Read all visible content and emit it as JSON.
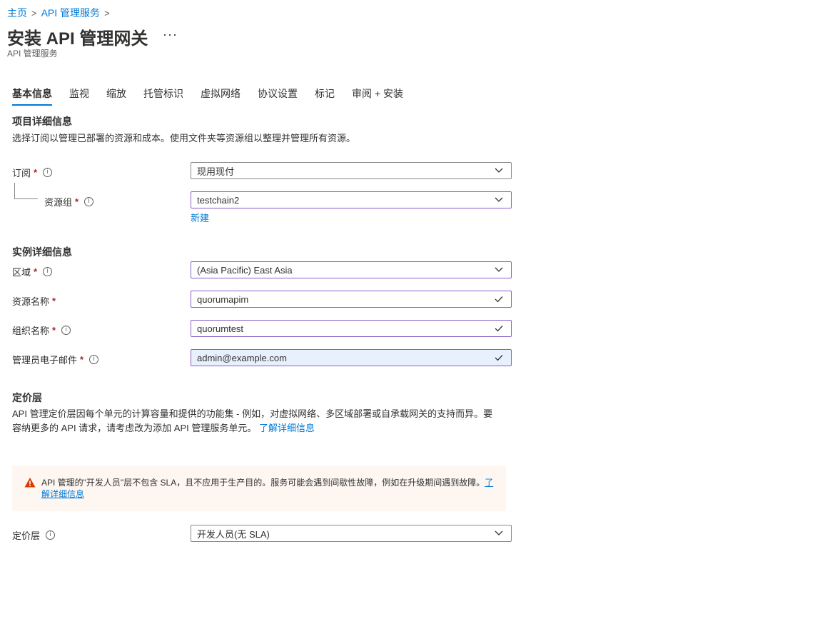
{
  "breadcrumb": {
    "home": "主页",
    "service": "API 管理服务",
    "sep": ">"
  },
  "header": {
    "title": "安装 API 管理网关",
    "more": "···",
    "subtitle": "API 管理服务"
  },
  "tabs": [
    {
      "label": "基本信息",
      "active": true
    },
    {
      "label": "监视"
    },
    {
      "label": "缩放"
    },
    {
      "label": "托管标识"
    },
    {
      "label": "虚拟网络"
    },
    {
      "label": "协议设置"
    },
    {
      "label": "标记"
    },
    {
      "label": "审阅 + 安装"
    }
  ],
  "project": {
    "title": "项目详细信息",
    "desc": "选择订阅以管理已部署的资源和成本。使用文件夹等资源组以整理并管理所有资源。",
    "subscription_label": "订阅",
    "subscription_value": "现用现付",
    "rg_label": "资源组",
    "rg_value": "testchain2",
    "rg_new": "新建"
  },
  "instance": {
    "title": "实例详细信息",
    "region_label": "区域",
    "region_value": "(Asia Pacific) East Asia",
    "name_label": "资源名称",
    "name_value": "quorumapim",
    "org_label": "组织名称",
    "org_value": "quorumtest",
    "email_label": "管理员电子邮件",
    "email_value": "admin@example.com"
  },
  "pricing": {
    "title": "定价层",
    "desc_line1": "API 管理定价层因每个单元的计算容量和提供的功能集 - 例如，对虚拟网络、多区域部署或自承载网关的支持而异。要",
    "desc_line2": "容纳更多的 API 请求，请考虑改为添加 API 管理服务单元。",
    "learn_more": "了解详细信息",
    "warning_text": "API 管理的\"开发人员\"层不包含 SLA，且不应用于生产目的。服务可能会遇到间歇性故障，例如在升级期间遇到故障。",
    "warning_link": "了解详细信息",
    "tier_label": "定价层",
    "tier_value": "开发人员(无 SLA)"
  },
  "symbols": {
    "required": "*",
    "info": "i"
  },
  "colors": {
    "accent": "#0078d4",
    "required": "#a4262c",
    "focus_border": "#8661c5",
    "warning": "#d83b01"
  }
}
